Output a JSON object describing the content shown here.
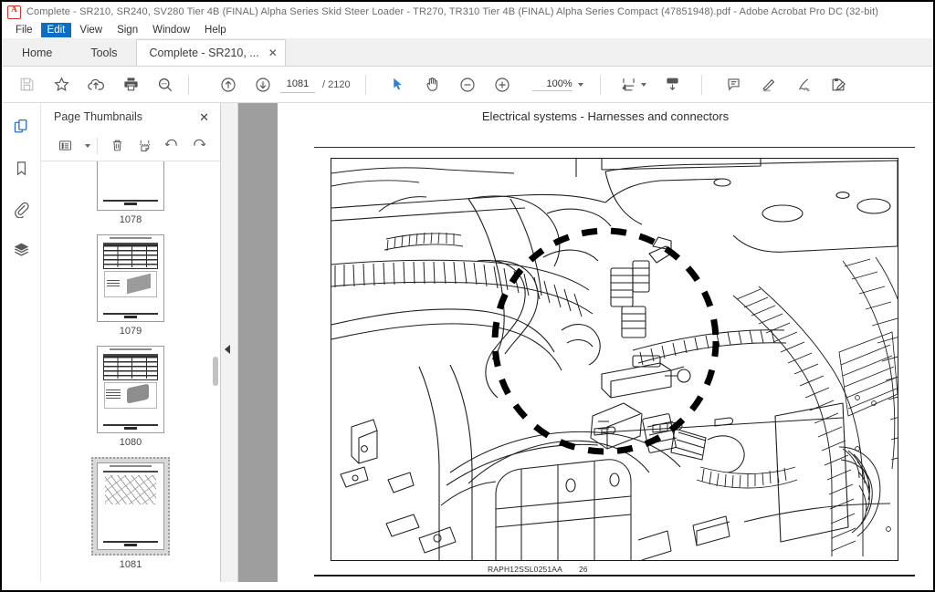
{
  "window": {
    "title": "Complete - SR210, SR240, SV280 Tier 4B (FINAL) Alpha Series Skid Steer Loader - TR270, TR310 Tier 4B (FINAL) Alpha Series Compact (47851948).pdf - Adobe Acrobat Pro DC (32-bit)",
    "logo_icon": "acrobat-logo-icon"
  },
  "menubar": {
    "items": [
      {
        "label": "File",
        "active": false
      },
      {
        "label": "Edit",
        "active": true
      },
      {
        "label": "View",
        "active": false
      },
      {
        "label": "Sign",
        "active": false
      },
      {
        "label": "Window",
        "active": false
      },
      {
        "label": "Help",
        "active": false
      }
    ],
    "active_accent": "#0b6ec4"
  },
  "tabs": {
    "home": "Home",
    "tools": "Tools",
    "document": "Complete - SR210, ...",
    "close_label": "✕"
  },
  "toolbar": {
    "left_icons": [
      {
        "name": "save-icon",
        "label": "Save"
      },
      {
        "name": "star-icon",
        "label": "Add to favorites"
      },
      {
        "name": "cloud-upload-icon",
        "label": "Upload to cloud"
      },
      {
        "name": "print-icon",
        "label": "Print file"
      },
      {
        "name": "search-icon",
        "label": "Find text"
      }
    ],
    "nav": {
      "previous_page_icon": "arrow-up-circle-icon",
      "next_page_icon": "arrow-down-circle-icon",
      "current_page": "1081",
      "page_separator": "/",
      "total_pages": "2120"
    },
    "tools": {
      "select_icon": "cursor-arrow-icon",
      "hand_icon": "hand-tool-icon",
      "zoom_out_icon": "zoom-out-icon",
      "zoom_in_icon": "zoom-in-icon",
      "zoom_level": "100%"
    },
    "right_icons": [
      {
        "name": "fit-width-icon",
        "label": "Fit page width"
      },
      {
        "name": "scroll-mode-icon",
        "label": "Page display / scrolling"
      },
      {
        "name": "comment-icon",
        "label": "Add comment"
      },
      {
        "name": "highlight-icon",
        "label": "Highlight text"
      },
      {
        "name": "sign-icon",
        "label": "Sign"
      },
      {
        "name": "fill-and-sign-icon",
        "label": "Fill & Sign"
      }
    ]
  },
  "rail": {
    "items": [
      {
        "name": "page-thumbnails-icon",
        "label": "Page Thumbnails",
        "active": true
      },
      {
        "name": "bookmarks-icon",
        "label": "Bookmarks",
        "active": false
      },
      {
        "name": "attachments-icon",
        "label": "Attachments",
        "active": false
      },
      {
        "name": "layers-icon",
        "label": "Layers",
        "active": false
      }
    ],
    "active_color": "#2e6fb7"
  },
  "thumbnails_panel": {
    "title": "Page Thumbnails",
    "close_label": "✕",
    "tools": [
      {
        "name": "thumbnail-options-icon",
        "label": "Options"
      },
      {
        "name": "delete-pages-icon",
        "label": "Delete Pages"
      },
      {
        "name": "extract-pages-icon",
        "label": "Extract Pages"
      },
      {
        "name": "rotate-ccw-icon",
        "label": "Rotate Counterclockwise"
      },
      {
        "name": "rotate-cw-icon",
        "label": "Rotate Clockwise"
      }
    ],
    "pages": [
      {
        "number": "1078",
        "selected": false,
        "kind": "partial"
      },
      {
        "number": "1079",
        "selected": false,
        "kind": "table"
      },
      {
        "number": "1080",
        "selected": false,
        "kind": "table"
      },
      {
        "number": "1081",
        "selected": true,
        "kind": "drawing"
      }
    ]
  },
  "collapse": {
    "icon": "collapse-left-arrow-icon"
  },
  "document": {
    "header_title": "Electrical systems - Harnesses and connectors",
    "figure": {
      "alt": "Technical line drawing of engine bay wiring harness with dashed circle callout",
      "caption_code": "RAPH12SSL0251AA",
      "caption_number": "26"
    }
  }
}
